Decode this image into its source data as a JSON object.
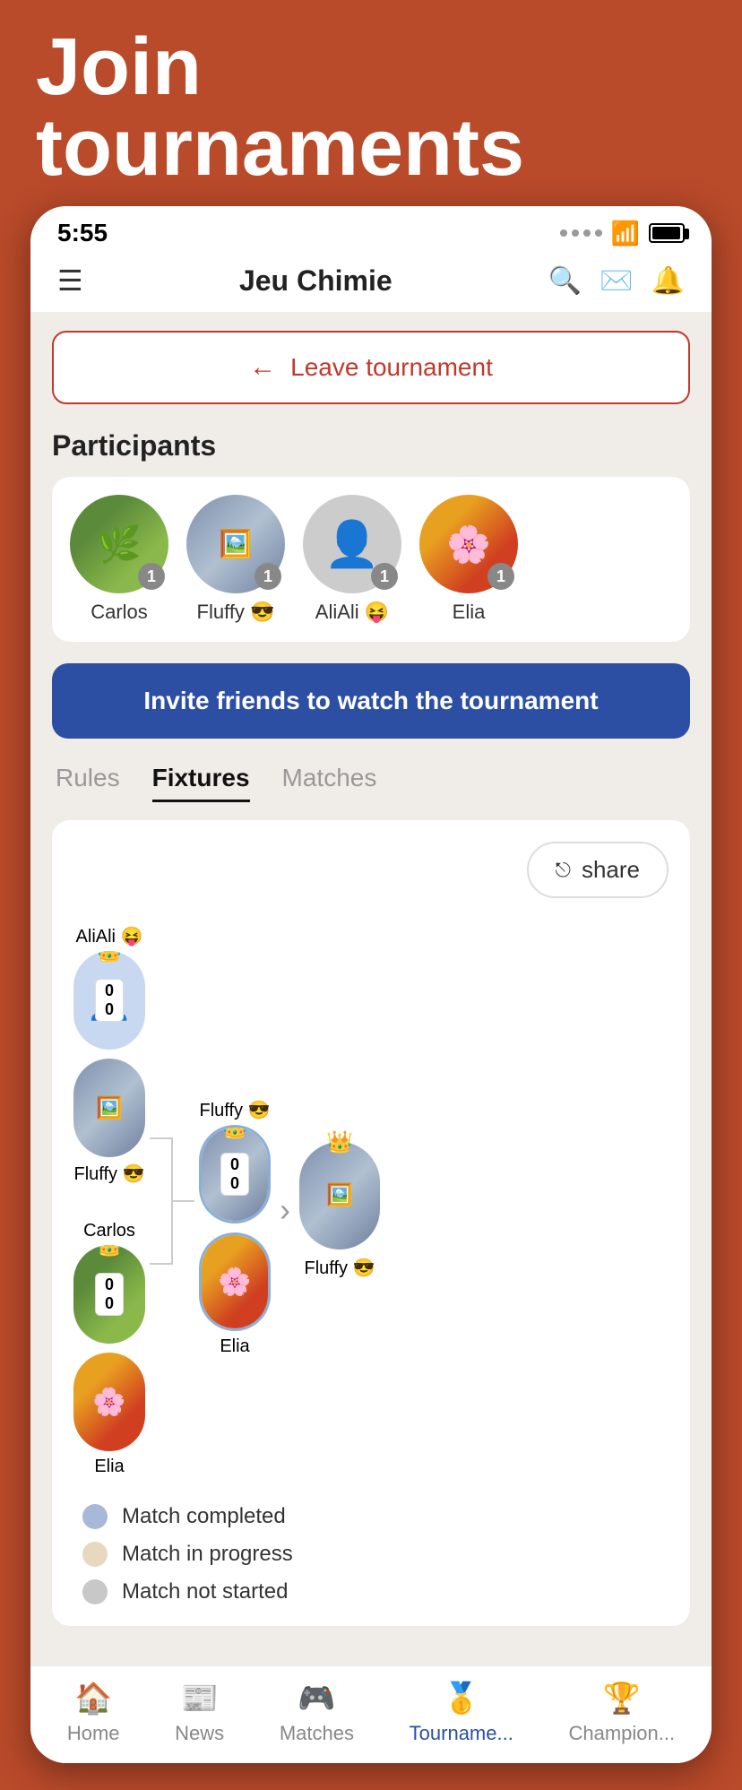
{
  "banner": {
    "title": "Join tournaments"
  },
  "statusBar": {
    "time": "5:55"
  },
  "appNav": {
    "title": "Jeu Chimie"
  },
  "leaveTournament": {
    "label": "Leave tournament"
  },
  "participants": {
    "sectionTitle": "Participants",
    "items": [
      {
        "name": "Carlos",
        "type": "plant",
        "badge": "1"
      },
      {
        "name": "Fluffy 😎",
        "type": "collage",
        "badge": "1"
      },
      {
        "name": "AliAli 😝",
        "type": "placeholder",
        "badge": "1"
      },
      {
        "name": "Elia",
        "type": "flower",
        "badge": "1"
      }
    ]
  },
  "inviteBtn": {
    "label": "Invite friends to watch the tournament"
  },
  "tabs": [
    {
      "label": "Rules",
      "active": false
    },
    {
      "label": "Fixtures",
      "active": true
    },
    {
      "label": "Matches",
      "active": false
    }
  ],
  "shareBtn": {
    "label": "share"
  },
  "bracket": {
    "round1": [
      {
        "players": [
          "AliAli 😝",
          "Fluffy 😎"
        ],
        "score": [
          "0",
          "0"
        ],
        "winner": "Fluffy 😎"
      },
      {
        "players": [
          "Carlos",
          "Elia"
        ],
        "score": [
          "0",
          "0"
        ],
        "winner": "Elia"
      }
    ],
    "round2": [
      {
        "players": [
          "Fluffy 😎",
          "Elia"
        ],
        "score": [
          "0",
          "0"
        ],
        "winner": "Fluffy 😎"
      }
    ],
    "final": {
      "name": "Fluffy 😎"
    }
  },
  "legend": [
    {
      "color": "#a8b8d8",
      "label": "Match completed"
    },
    {
      "color": "#e8d8c0",
      "label": "Match in progress"
    },
    {
      "color": "#c8c8c8",
      "label": "Match not started"
    }
  ],
  "bottomNav": {
    "items": [
      {
        "label": "Home",
        "icon": "🏠",
        "active": false
      },
      {
        "label": "News",
        "icon": "📰",
        "active": false
      },
      {
        "label": "Matches",
        "icon": "🎮",
        "active": false
      },
      {
        "label": "Tourname...",
        "icon": "🥇",
        "active": true
      },
      {
        "label": "Champion...",
        "icon": "🏆",
        "active": false
      }
    ]
  }
}
